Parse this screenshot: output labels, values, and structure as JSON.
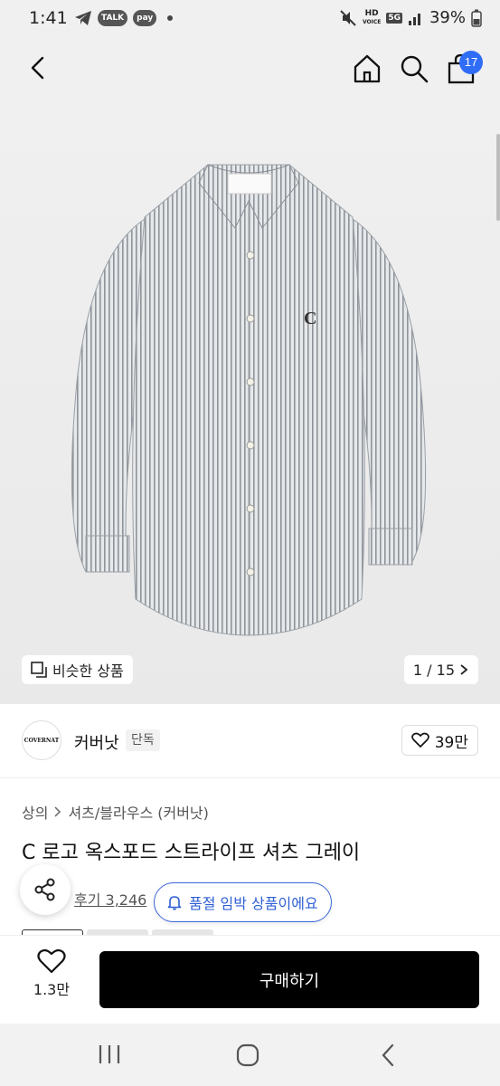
{
  "status_bar": {
    "time": "1:41",
    "chip_talk": "TALK",
    "chip_pay": "pay",
    "hd_label": "HD",
    "voice_label": "VOICE",
    "network": "5G",
    "battery": "39%"
  },
  "header": {
    "cart_count": "17",
    "icons": [
      "back-icon",
      "home-icon",
      "search-icon",
      "cart-icon"
    ]
  },
  "gallery": {
    "similar_label": "비슷한 상품",
    "pager_text": "1 / 15",
    "logo_on_shirt": "C"
  },
  "brand": {
    "logo_text": "COVERNAT",
    "name": "커버낫",
    "tag": "단독",
    "likes": "39만"
  },
  "product": {
    "breadcrumb": [
      "상의",
      "셔츠/블라우스 (커버낫)"
    ],
    "title": "C 로고 옥스포드 스트라이프 셔츠 그레이",
    "reviews": "후기 3,246"
  },
  "stock_notice": "품절 임박 상품이에요",
  "action_bar": {
    "wish_count": "1.3만",
    "buy_label": "구매하기"
  },
  "colors": {
    "accent_blue": "#2f6df6",
    "buy_button": "#000000"
  }
}
